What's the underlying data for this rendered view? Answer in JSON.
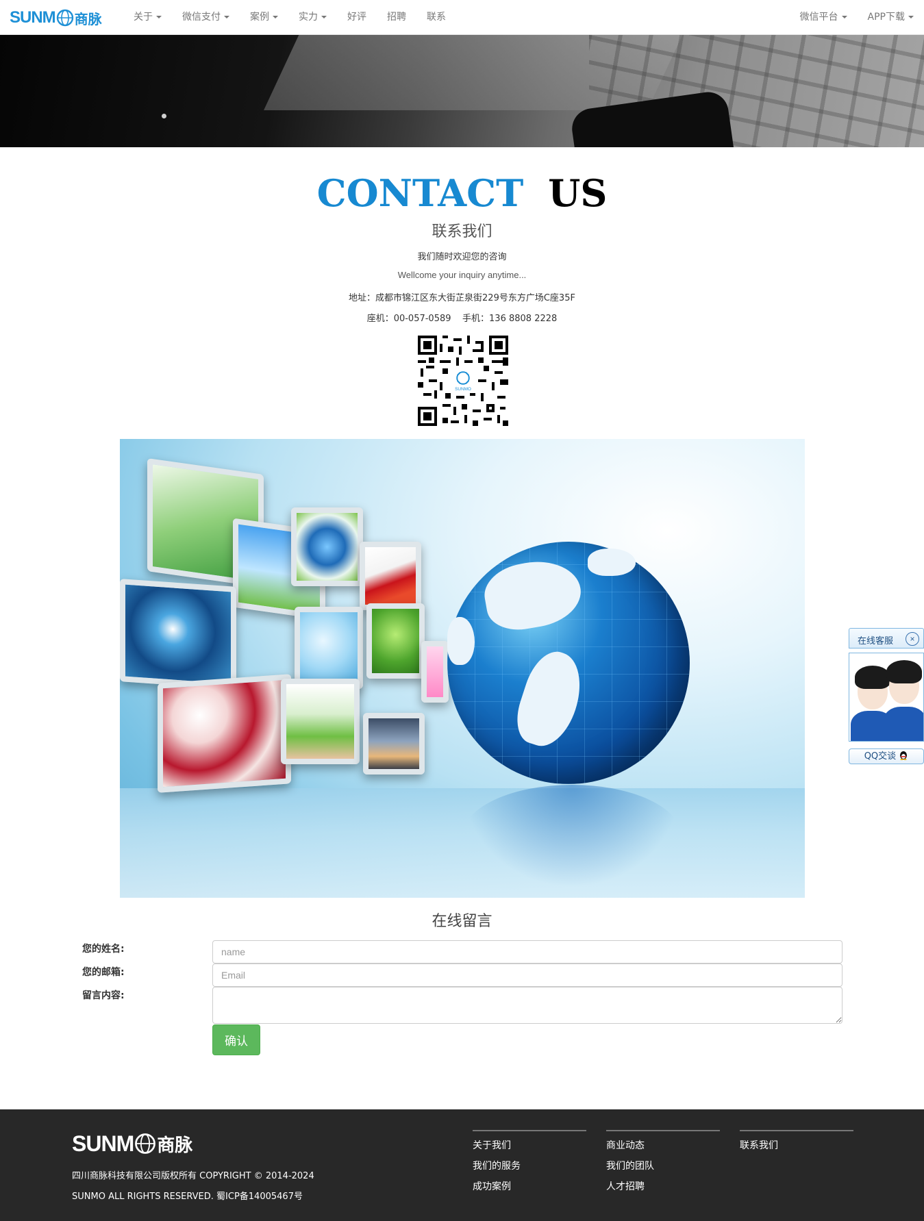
{
  "navbar": {
    "brand_en": "SUNM",
    "brand_cn": "商脉",
    "left_items": [
      {
        "label": "关于",
        "dropdown": true
      },
      {
        "label": "微信支付",
        "dropdown": true
      },
      {
        "label": "案例",
        "dropdown": true
      },
      {
        "label": "实力",
        "dropdown": true
      },
      {
        "label": "好评",
        "dropdown": false
      },
      {
        "label": "招聘",
        "dropdown": false
      },
      {
        "label": "联系",
        "dropdown": false
      }
    ],
    "right_items": [
      {
        "label": "微信平台",
        "dropdown": true
      },
      {
        "label": "APP下载",
        "dropdown": true
      }
    ]
  },
  "contact": {
    "title_en_1": "CONTACT",
    "title_en_2": "US",
    "title_cn": "联系我们",
    "welcome_cn": "我们随时欢迎您的咨询",
    "welcome_en": "Wellcome your inquiry anytime...",
    "address": "地址：成都市锦江区东大街芷泉街229号东方广场C座35F",
    "phone": "座机：00-057-0589    手机：136 8808 2228"
  },
  "qr": {
    "center_label": "SUNMO"
  },
  "message_form": {
    "title": "在线留言",
    "name_label": "您的姓名:",
    "name_placeholder": "name",
    "email_label": "您的邮箱:",
    "email_placeholder": "Email",
    "content_label": "留言内容:",
    "submit_label": "确认"
  },
  "qq_widget": {
    "title": "在线客服",
    "close": "×",
    "talk_label": "QQ交谈"
  },
  "footer": {
    "brand_en": "SUNM",
    "brand_cn": "商脉",
    "copyright": "四川商脉科技有限公司版权所有 COPYRIGHT © 2014-2024",
    "rights": "SUNMO ALL RIGHTS RESERVED. 蜀ICP备14005467号",
    "columns": [
      {
        "links": [
          "关于我们",
          "我们的服务",
          "成功案例"
        ]
      },
      {
        "links": [
          "商业动态",
          "我们的团队",
          "人才招聘"
        ]
      },
      {
        "links": [
          "联系我们"
        ]
      }
    ]
  },
  "colors": {
    "brand_blue": "#1789d1",
    "button_green": "#5cb85c",
    "footer_bg": "#282828"
  }
}
